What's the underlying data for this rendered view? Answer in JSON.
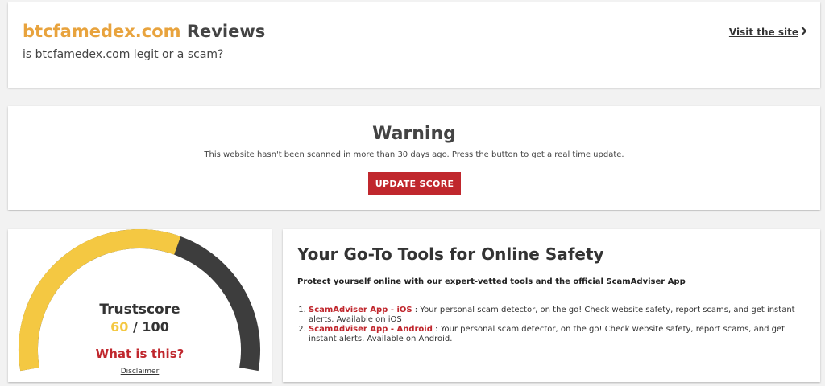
{
  "header": {
    "domain": "btcfamedex.com",
    "title_suffix": " Reviews",
    "subtitle": "is btcfamedex.com legit or a scam?",
    "visit_label": "Visit the site",
    "visit_icon": "chevron-right-icon"
  },
  "warning": {
    "title": "Warning",
    "text": "This website hasn't been scanned in more than 30 days ago. Press the button to get a real time update.",
    "button_label": "UPDATE SCORE"
  },
  "trust": {
    "label": "Trustscore",
    "score": "60",
    "separator": " / ",
    "max": "100",
    "score_value": 60,
    "max_value": 100,
    "what_label": "What is this?",
    "disclaimer_label": "Disclaimer"
  },
  "tools": {
    "title": "Your Go-To Tools for Online Safety",
    "subtitle": "Protect yourself online with our expert-vetted tools and the official ScamAdviser App",
    "items": [
      {
        "app_name": "ScamAdviser App - iOS",
        "description": " : Your personal scam detector, on the go! Check website safety, report scams, and get instant alerts. Available on iOS"
      },
      {
        "app_name": "ScamAdviser App - Android",
        "description": " : Your personal scam detector, on the go! Check website safety, report scams, and get instant alerts. Available on Android."
      }
    ]
  },
  "colors": {
    "domain": "#e8a33d",
    "accent_red": "#c0272d",
    "gauge_fill": "#f4c842",
    "gauge_rest": "#3d3d3d",
    "background": "#f2f2f2"
  }
}
